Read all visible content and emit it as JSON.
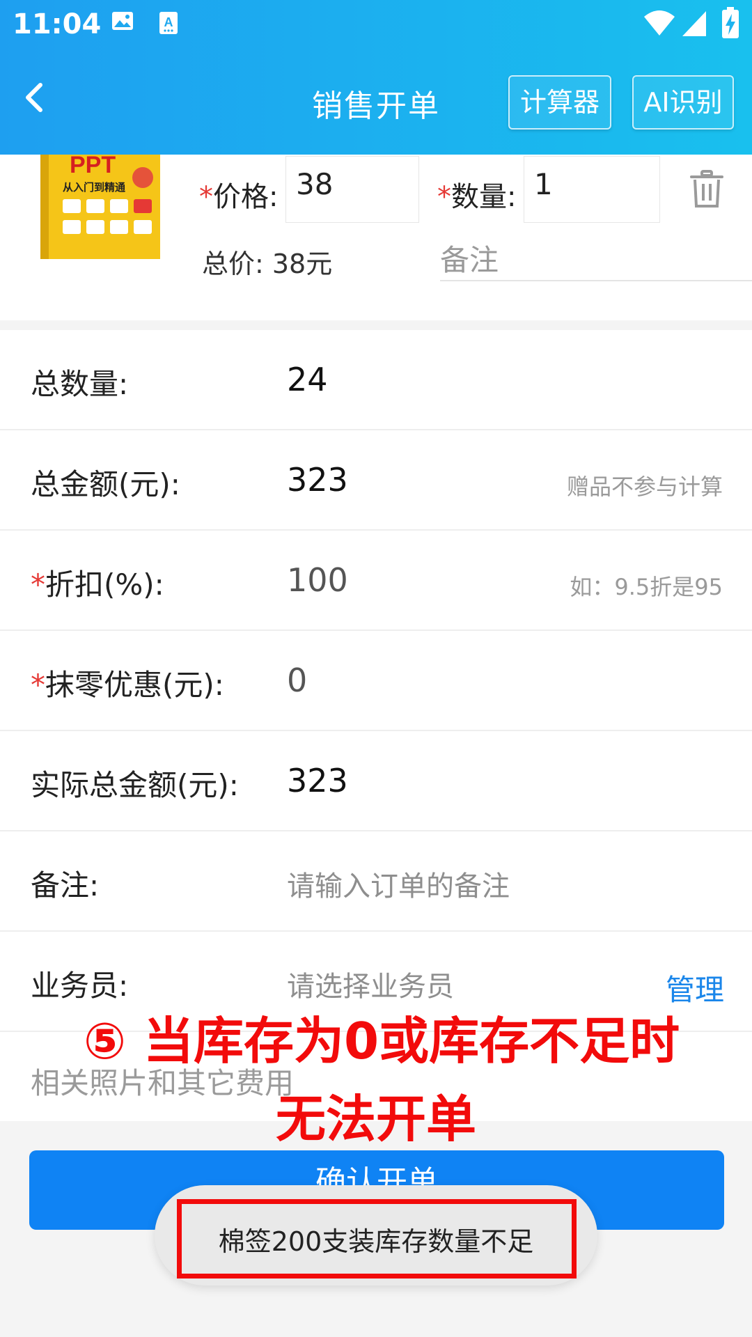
{
  "status_bar": {
    "time": "11:04",
    "icons": [
      "gallery-icon",
      "a-icon",
      "wifi-icon",
      "signal-icon",
      "battery-icon"
    ]
  },
  "toolbar": {
    "title": "销售开单",
    "calculator_label": "计算器",
    "ai_label": "AI识别",
    "back_icon": "chevron-left-icon"
  },
  "product": {
    "image_text": {
      "title": "PPT",
      "subtitle": "从入门到精通"
    },
    "price_label": "价格:",
    "price_value": "38",
    "quantity_label": "数量:",
    "quantity_value": "1",
    "total_price": "总价: 38元",
    "remark_placeholder": "备注",
    "required_mark": "*"
  },
  "form": {
    "rows": [
      {
        "label": "总数量:",
        "value": "24"
      },
      {
        "label": "总金额(元):",
        "value": "323",
        "hint": "赠品不参与计算"
      },
      {
        "label": "折扣(%):",
        "value": "100",
        "hint": "如：9.5折是95"
      },
      {
        "label": "抹零优惠(元):",
        "value": "0"
      },
      {
        "label": "实际总金额(元):",
        "value": "323"
      },
      {
        "label": "备注:",
        "placeholder": "请输入订单的备注"
      },
      {
        "label": "业务员:",
        "placeholder": "请选择业务员",
        "link": "管理"
      },
      {
        "label": "相关照片和其它费用"
      }
    ]
  },
  "confirm_label": "确认开单",
  "toast": "棉签200支装库存数量不足",
  "annotation": {
    "line1": "⑤ 当库存为0或库存不足时",
    "line2": "无法开单"
  },
  "colors": {
    "header_start": "#1e9ff0",
    "header_end": "#19c0ee",
    "primary": "#0f83f4",
    "required": "#e53935",
    "annotation": "#f20b0b",
    "link": "#1a86ea"
  }
}
